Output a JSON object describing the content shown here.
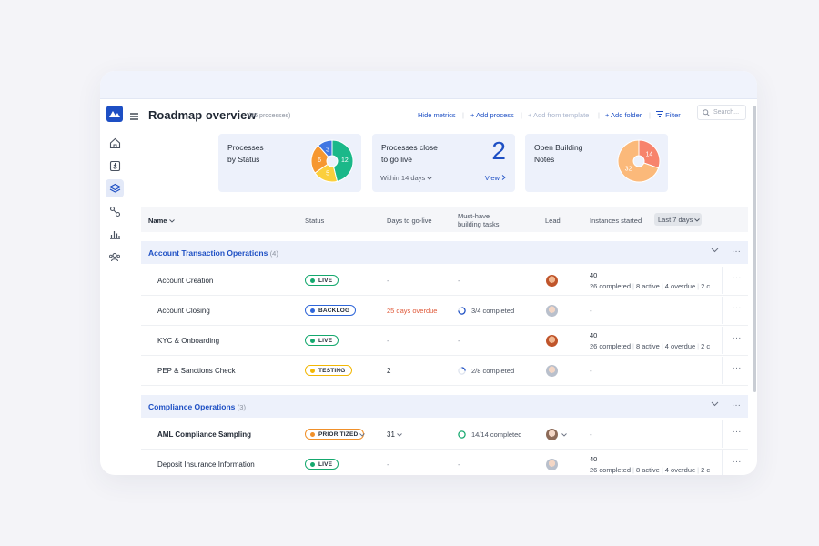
{
  "header": {
    "title": "Roadmap overview",
    "count": "(36 processes)",
    "hide_metrics": "Hide metrics",
    "add_process": "+ Add process",
    "add_template": "+ Add from template",
    "add_folder": "+ Add folder",
    "filter": "Filter",
    "search_placeholder": "Search..."
  },
  "metrics": {
    "status_card": {
      "label_line1": "Processes",
      "label_line2": "by Status",
      "values": [
        12,
        5,
        6,
        3
      ],
      "colors": [
        "#1bb889",
        "#fbcf3d",
        "#f69730",
        "#4177e2"
      ]
    },
    "golive_card": {
      "label_line1": "Processes close",
      "label_line2": "to go live",
      "value": "2",
      "period": "Within 14 days",
      "view": "View"
    },
    "notes_card": {
      "label_line1": "Open Building",
      "label_line2": "Notes",
      "values": [
        14,
        32
      ],
      "colors": [
        "#f7836c",
        "#fbb97a"
      ]
    }
  },
  "table": {
    "columns": {
      "name": "Name",
      "status": "Status",
      "days": "Days to go-live",
      "tasks_line1": "Must-have",
      "tasks_line2": "building tasks",
      "lead": "Lead",
      "instances": "Instances started",
      "period": "Last 7 days"
    },
    "groups": [
      {
        "name": "Account Transaction Operations",
        "count": "(4)",
        "rows": [
          {
            "name": "Account Creation",
            "status": "LIVE",
            "days": "-",
            "tasks": "-",
            "instances_total": "40",
            "completed": "26 completed",
            "active": "8 active",
            "overdue": "4 overdue",
            "extra": "2 c"
          },
          {
            "name": "Account Closing",
            "status": "BACKLOG",
            "days": "25 days overdue",
            "tasks": "3/4 completed",
            "instances": "-"
          },
          {
            "name": "KYC & Onboarding",
            "status": "LIVE",
            "days": "-",
            "tasks": "-",
            "instances_total": "40",
            "completed": "26 completed",
            "active": "8 active",
            "overdue": "4 overdue",
            "extra": "2 c"
          },
          {
            "name": "PEP & Sanctions Check",
            "status": "TESTING",
            "days": "2",
            "tasks": "2/8 completed",
            "instances": "-"
          }
        ]
      },
      {
        "name": "Compliance Operations",
        "count": "(3)",
        "rows": [
          {
            "name": "AML Compliance Sampling",
            "status": "PRIORITIZED",
            "days": "31",
            "tasks": "14/14 completed",
            "instances": "-"
          },
          {
            "name": "Deposit Insurance Information",
            "status": "LIVE",
            "days": "-",
            "tasks": "-",
            "instances_total": "40",
            "completed": "26 completed",
            "active": "8 active",
            "overdue": "4 overdue",
            "extra": "2 c"
          }
        ]
      }
    ]
  },
  "status_colors": {
    "LIVE": "#15a86e",
    "BACKLOG": "#2f66d8",
    "TESTING": "#f2b705",
    "PRIORITIZED": "#f0902a"
  },
  "more_label": "···"
}
